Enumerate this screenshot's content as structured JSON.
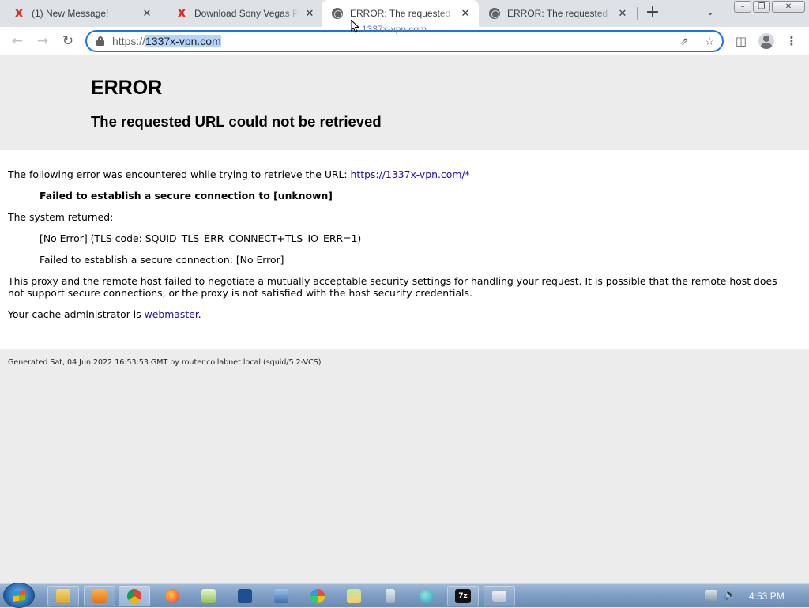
{
  "browser": {
    "tabs": [
      {
        "title": "(1) New Message!",
        "favicon": "x-icon",
        "active": false
      },
      {
        "title": "Download Sony Vegas Pro",
        "favicon": "x-icon",
        "active": false
      },
      {
        "title": "ERROR: The requested URL",
        "favicon": "globe-icon",
        "active": true
      },
      {
        "title": "ERROR: The requested URL",
        "favicon": "globe-icon",
        "active": false
      }
    ],
    "url_scheme": "https://",
    "url_host": "1337x-vpn.com",
    "drag_ghost_text": "1337x-vpn.com",
    "colors": {
      "accent": "#1a73e8",
      "tab_strip": "#dee1e6",
      "selection": "#b4d4fb"
    }
  },
  "page": {
    "title": "ERROR",
    "subtitle": "The requested URL could not be retrieved",
    "intro_text": "The following error was encountered while trying to retrieve the URL: ",
    "intro_link": "https://1337x-vpn.com/*",
    "error_summary": "Failed to establish a secure connection to [unknown]",
    "system_returned": "The system returned:",
    "tls_code": "[No Error] (TLS code: SQUID_TLS_ERR_CONNECT+TLS_IO_ERR=1)",
    "secure_failed": "Failed to establish a secure connection: [No Error]",
    "explanation": "This proxy and the remote host failed to negotiate a mutually acceptable security settings for handling your request. It is possible that the remote host does not support secure connections, or the proxy is not satisfied with the host security credentials.",
    "admin_prefix": "Your cache administrator is ",
    "admin_link": "webmaster",
    "admin_suffix": ".",
    "footer": "Generated Sat, 04 Jun 2022 16:53:53 GMT by router.collabnet.local (squid/5.2-VCS)"
  },
  "taskbar": {
    "clock": "4:53 PM",
    "apps": [
      "explorer",
      "media-player",
      "chrome",
      "firefox",
      "notepad",
      "powershell",
      "network",
      "paint",
      "files",
      "calculator",
      "globe",
      "7-zip",
      "control-panel"
    ]
  }
}
